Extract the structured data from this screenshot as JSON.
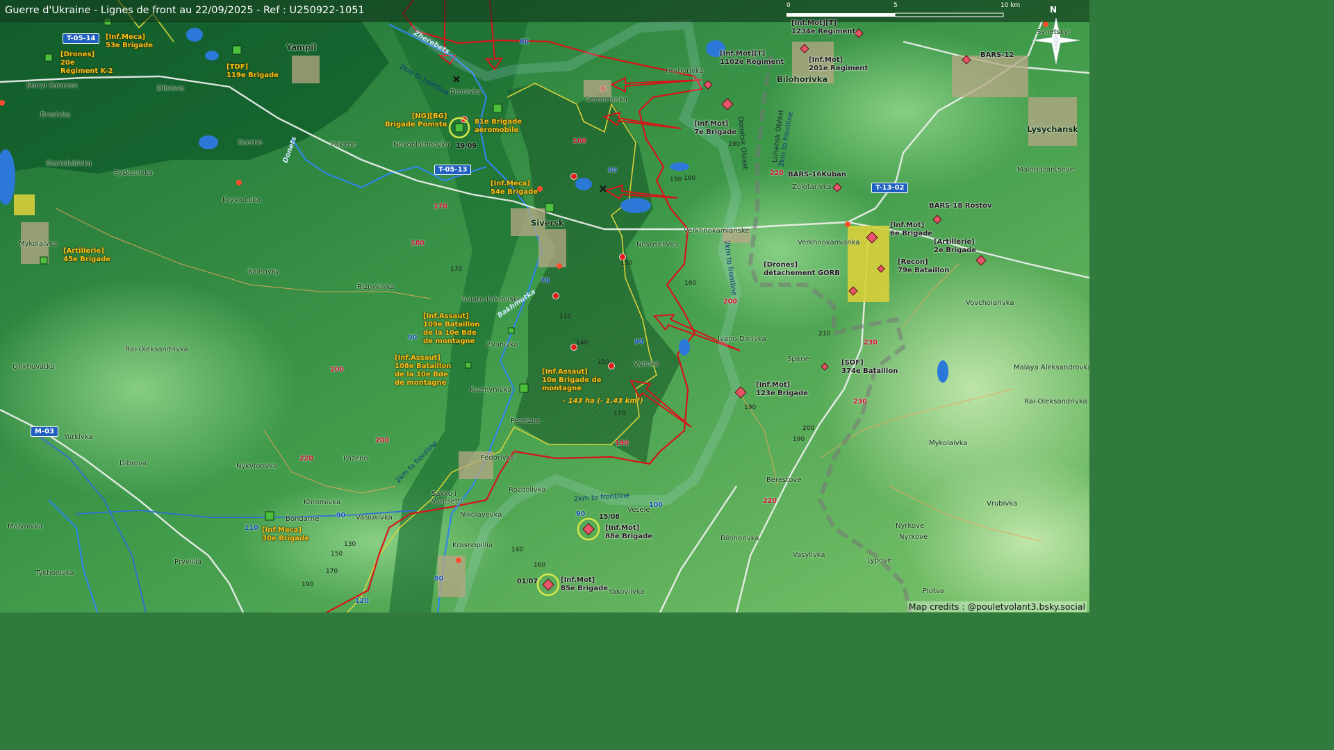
{
  "title": "Guerre d'Ukraine - Lignes de front au 22/09/2025 - Ref : U250922-1051",
  "credits": "Map credits : @pouletvolant3.bsky.social",
  "scale": {
    "s0": "0",
    "s5": "5",
    "s10": "10 km"
  },
  "north": "N",
  "colors": {
    "ukr_units": "#f6c21a",
    "ru_units": "#e8556a",
    "front": "#d7141a",
    "terrain_low": "#1f7a36",
    "terrain_high": "#bfe6a7"
  },
  "places": {
    "yampil": "Yampil",
    "siversk": "Siversk",
    "bilohorivka_n": "Bilohorivka",
    "lysychansk": "Lysychansk",
    "staryi_karavan": "Staryi Karavan",
    "dibrova_n": "Dibrova",
    "brusivka": "Brusivka",
    "ozerne": "Ozerne",
    "starodubivka": "Starodubivka",
    "pyskunivka": "Pyskunivka",
    "kryva_luka": "Kryva Luka",
    "mykolaivka_w": "Mykolaivka",
    "zakitne": "Zakitne",
    "novoplatonovka": "Novoplatonovka",
    "dronivka": "Dronivka",
    "serebrianka": "Serebrianka",
    "hryhorivka": "Hryhorivka",
    "synytskyi": "Synetskyi",
    "maloriazantseve": "Maloriazantseve",
    "zolotarivka": "Zolotarivka",
    "verkhnokamianske": "Verkhnokamianske",
    "verkhnokamianka": "Verkhnokamianka",
    "novoselivka": "Novoselivka",
    "kalenyky": "Kalenyky",
    "riznykivka": "Riznykivka",
    "sviato_pokrovske": "Sviato-Pokrovske",
    "zvanivka": "Zvanivka",
    "kuzmynivka": "Kuzmynivka",
    "pereizne": "Pereizne",
    "fedorivka": "Fedorivka",
    "rai_oleksandrivka_w": "Rai-Oleksandrivka",
    "orikhuvatka": "Orikhuvatka",
    "yurkivka": "Yurkivka",
    "dibrova_s": "Dibrova",
    "nykyforivka": "Nykyforivka",
    "pazeno": "Pazeno",
    "ivano_darivka": "Ivano-Darivka",
    "vyimka": "Vyimka",
    "spirne": "Spirne",
    "vovchoiarivka": "Vovchoiarivka",
    "malaya_aleksandrovka": "Malaya Aleksandrovka",
    "rai_oleksandrivka_e": "Rai-Oleksandrivka",
    "mykolaivka_e": "Mykolaivka",
    "berestove": "Berestove",
    "vrubivka": "Vrubivka",
    "nyrkove1": "Nyrkove",
    "nyrkove2": "Nyrkove",
    "lypove": "Lypove",
    "plotva": "Plotva",
    "vasylivka": "Vasylivka",
    "bilohorivka_s": "Bilohorivka",
    "vesele": "Vesele",
    "yakovlivka": "Yakovlivka",
    "rozdolivka": "Rozdolivka",
    "sakko_vantsetti": "Sakko i Vantsetti",
    "nikolayevka": "Nikolayevka",
    "krasnopillia": "Krasnopillia",
    "khromivka": "Khromivka",
    "bondarne": "Bondarne",
    "vasiukivka": "Vasiukivka",
    "malynivka": "Malynivka",
    "pryvillia": "Pryvillia",
    "tykhonivka": "Tykhonivka",
    "bars12": "BARS-12",
    "bars16": "BARS-16Kuban",
    "bars18": "BARS-18 Rostov"
  },
  "ukr_units": {
    "u53": "[Inf.Meca]\n53e Brigade",
    "u20": "[Drones]\n20e\nRégiment K-2",
    "u119": "[TDF]\n119e Brigade",
    "upomsta": "[NG][BG]\nBrigade Pomsta",
    "u81": "81e Brigade\naéromobile",
    "u54": "[Inf.Meca]\n54e Brigade",
    "u45": "[Artillerie]\n45e Brigade",
    "u109": "[Inf.Assaut]\n109e Bataillon\nde la 10e Bde\nde montagne",
    "u108": "[Inf.Assaut]\n108e Bataillon\nde la 10e Bde\nde montagne",
    "u10": "[Inf.Assaut]\n10e Brigade de\nmontagne",
    "u30": "[Inf.Meca]\n30e Brigade"
  },
  "ru_units": {
    "r1234": "[Inf.Mot][T]\n1234e Régiment",
    "r1102": "[Inf.Mot][T]\n1102e Régiment",
    "r201": "[Inf.Mot]\n201e Régiment",
    "r7": "[Inf.Mot]\n7e Brigade",
    "r6": "[Inf.Mot]\n6e Brigade",
    "r2a": "[Artillerie]\n2e Brigade",
    "rgorb": "[Drones]\ndétachement GORB",
    "r79": "[Recon]\n79e Bataillon",
    "r374": "[SOF]\n374e Bataillon",
    "r123": "[Inf.Mot]\n123e Brigade",
    "r88": "[Inf.Mot]\n88e Brigade",
    "r85": "[Inf.Mot]\n85e Brigade"
  },
  "roads": {
    "t0514": "T-05-14",
    "t0513": "T-05-13",
    "t1302": "T-13-02",
    "m03": "M-03"
  },
  "road_numbers": {
    "n60": "60",
    "n90a": "90",
    "n70": "70",
    "n90b": "90",
    "n90c": "90",
    "n90d": "90",
    "n90e": "90",
    "n100": "100",
    "n110": "110",
    "n80": "80",
    "n120": "120"
  },
  "elev_red": {
    "e160": "160",
    "e170": "170",
    "e180": "180",
    "e200a": "200",
    "e220a": "220",
    "e200b": "200",
    "e190": "190",
    "e200c": "200",
    "e220b": "220",
    "e230a": "230",
    "e230b": "230",
    "e220c": "220"
  },
  "elev": {
    "e190a": "190",
    "e150a": "150",
    "e160a": "160",
    "e170a": "170",
    "e150b": "150",
    "e160b": "160",
    "e110": "110",
    "e140a": "140",
    "e150c": "150",
    "e170b": "170",
    "e210": "210",
    "e190b": "190",
    "e200": "200",
    "e190c": "190",
    "e130": "130",
    "e150d": "150",
    "e170c": "170",
    "e190d": "190",
    "e140b": "140",
    "e160c": "160"
  },
  "rivers": {
    "zherebets": "Zherebets",
    "donets": "Donets",
    "bakhmutka": "Bakhmutka"
  },
  "leads": {
    "l1": "2km to frontline",
    "l2": "2km to frontline",
    "l3": "2km to frontline",
    "l4": "2km to frontline",
    "l5": "2km to frontline"
  },
  "oblasts": {
    "donetsk": "Donetsk Oblast",
    "luhansk": "Luhansk Oblast"
  },
  "dates": {
    "d1909": "19/09",
    "d1508": "15/08",
    "d0107": "01/07"
  },
  "area_change": "- 143 ha (- 1.43 km²)"
}
